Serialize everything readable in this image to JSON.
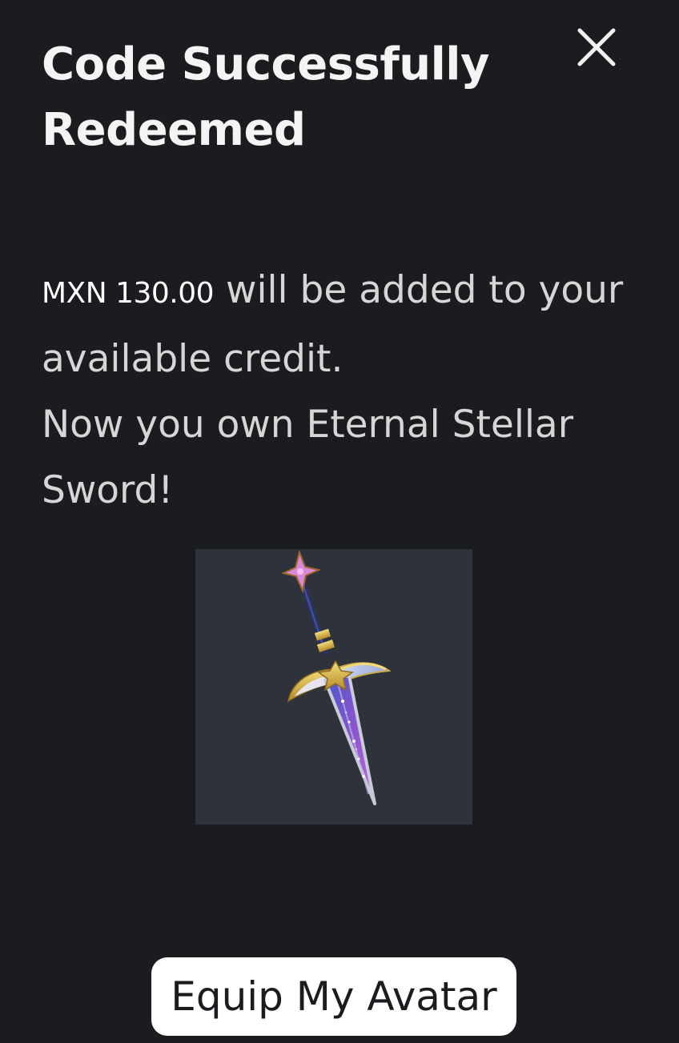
{
  "modal": {
    "title": "Code Successfully Redeemed",
    "close_icon": "close-icon",
    "amount": "MXN 130.00",
    "credit_text": " will be added to your available credit.",
    "ownership_text": "Now you own Eternal Stellar Sword!",
    "item_image_icon": "sword-icon",
    "equip_button_label": "Equip My Avatar"
  },
  "colors": {
    "background": "#1b1c20",
    "image_background": "#2e323b",
    "button_background": "#ffffff",
    "text_primary": "#f4f4f4"
  }
}
